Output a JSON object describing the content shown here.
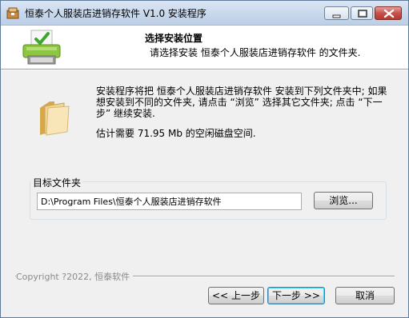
{
  "window": {
    "title": "恒泰个人服装店进销存软件 V1.0 安装程序",
    "icons": {
      "app": "installer-box-icon",
      "minimize": "minimize-icon",
      "maximize": "maximize-icon",
      "close": "close-icon"
    }
  },
  "header": {
    "title": "选择安装位置",
    "subtitle": "请选择安装 恒泰个人服装店进销存软件 的文件夹.",
    "icon": "printer-check-icon"
  },
  "body": {
    "folder_icon": "folder-icon",
    "description": "安装程序将把 恒泰个人服装店进销存软件 安装到下列文件夹中; 如果想安装到不同的文件夹, 请点击 “浏览” 选择其它文件夹; 点击 “下一步” 继续安装.",
    "space_required": "估计需要 71.95 Mb 的空闲磁盘空间."
  },
  "destination": {
    "group_label": "目标文件夹",
    "path": "D:\\Program Files\\恒泰个人服装店进销存软件",
    "browse_label": "浏览..."
  },
  "footer": {
    "branding": "Copyright  ?2022, 恒泰软件",
    "back_label": "<< 上一步",
    "next_label": "下一步 >>",
    "cancel_label": "取消"
  },
  "colors": {
    "titlebar": "#c8d8ec",
    "close_button": "#c75050",
    "dialog_bg": "#f0f0f0",
    "default_button_glow": "#48d0f7"
  }
}
